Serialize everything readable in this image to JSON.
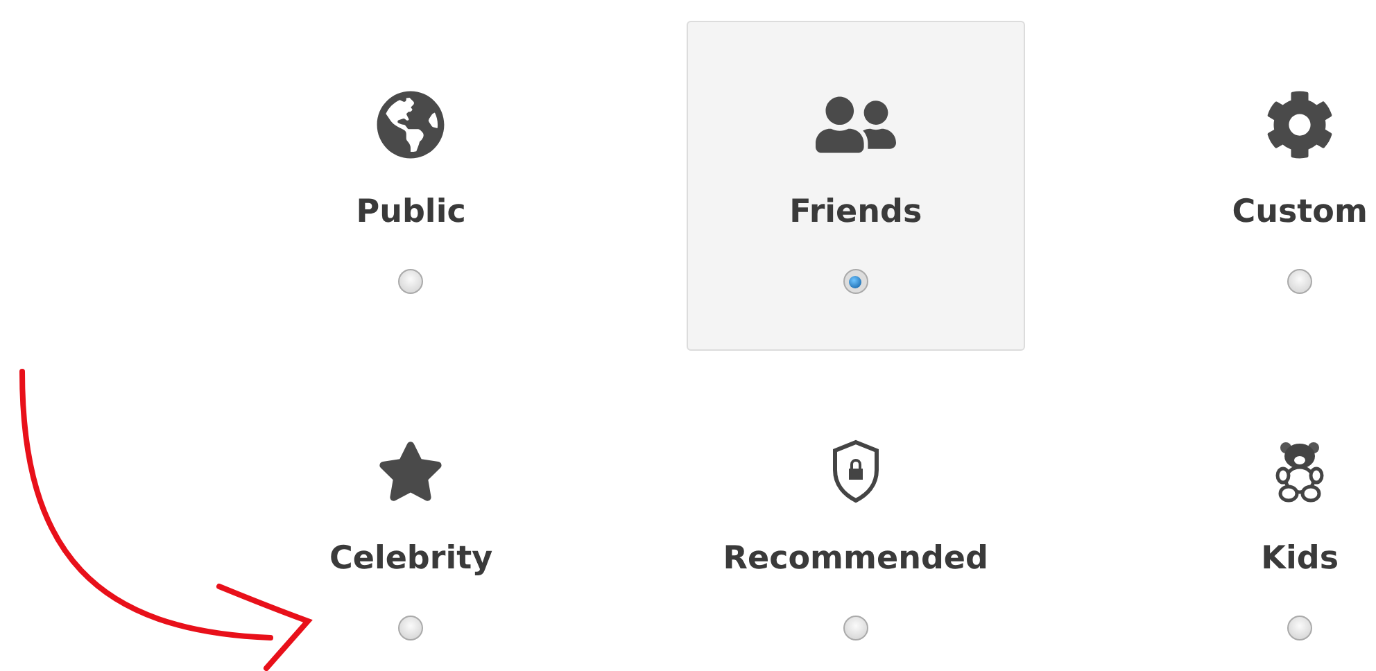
{
  "options": [
    {
      "label": "Public",
      "kind": "globe",
      "selected": false
    },
    {
      "label": "Friends",
      "kind": "friends",
      "selected": true
    },
    {
      "label": "Custom",
      "kind": "gear",
      "selected": false
    },
    {
      "label": "Celebrity",
      "kind": "star",
      "selected": false
    },
    {
      "label": "Recommended",
      "kind": "shield",
      "selected": false
    },
    {
      "label": "Kids",
      "kind": "bear",
      "selected": false
    }
  ]
}
